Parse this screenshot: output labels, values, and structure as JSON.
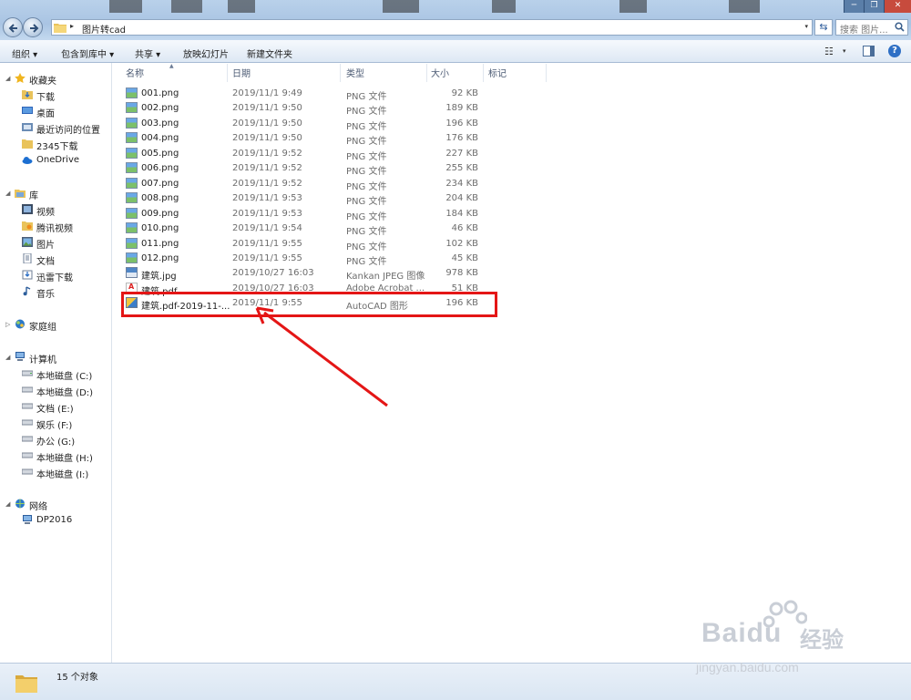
{
  "window": {
    "min_glyph": "─",
    "max_glyph": "❐",
    "close_glyph": "✕"
  },
  "address": {
    "arrow": "▸",
    "path": "图片转cad",
    "dropdown": "▾",
    "refresh_glyph": "⇆"
  },
  "search": {
    "placeholder": "搜索 图片..."
  },
  "toolbar": {
    "organize": "组织 ▾",
    "include_library": "包含到库中 ▾",
    "share": "共享 ▾",
    "slideshow": "放映幻灯片",
    "new_folder": "新建文件夹",
    "view_glyph": "☷",
    "view_dd": "▾",
    "help": "?"
  },
  "nav": {
    "favorites": {
      "label": "收藏夹",
      "items": [
        "下载",
        "桌面",
        "最近访问的位置",
        "2345下载",
        "OneDrive"
      ]
    },
    "libraries": {
      "label": "库",
      "items": [
        "视频",
        "腾讯视频",
        "图片",
        "文档",
        "迅雷下载",
        "音乐"
      ]
    },
    "homegroup": {
      "label": "家庭组"
    },
    "computer": {
      "label": "计算机",
      "items": [
        "本地磁盘 (C:)",
        "本地磁盘 (D:)",
        "文档 (E:)",
        "娱乐 (F:)",
        "办公 (G:)",
        "本地磁盘 (H:)",
        "本地磁盘 (I:)"
      ]
    },
    "network": {
      "label": "网络",
      "items": [
        "DP2016"
      ]
    }
  },
  "columns": {
    "name": "名称",
    "date": "日期",
    "type": "类型",
    "size": "大小",
    "tags": "标记"
  },
  "files": [
    {
      "name": "001.png",
      "date": "2019/11/1 9:49",
      "type": "PNG 文件",
      "size": "92 KB"
    },
    {
      "name": "002.png",
      "date": "2019/11/1 9:50",
      "type": "PNG 文件",
      "size": "189 KB"
    },
    {
      "name": "003.png",
      "date": "2019/11/1 9:50",
      "type": "PNG 文件",
      "size": "196 KB"
    },
    {
      "name": "004.png",
      "date": "2019/11/1 9:50",
      "type": "PNG 文件",
      "size": "176 KB"
    },
    {
      "name": "005.png",
      "date": "2019/11/1 9:52",
      "type": "PNG 文件",
      "size": "227 KB"
    },
    {
      "name": "006.png",
      "date": "2019/11/1 9:52",
      "type": "PNG 文件",
      "size": "255 KB"
    },
    {
      "name": "007.png",
      "date": "2019/11/1 9:52",
      "type": "PNG 文件",
      "size": "234 KB"
    },
    {
      "name": "008.png",
      "date": "2019/11/1 9:53",
      "type": "PNG 文件",
      "size": "204 KB"
    },
    {
      "name": "009.png",
      "date": "2019/11/1 9:53",
      "type": "PNG 文件",
      "size": "184 KB"
    },
    {
      "name": "010.png",
      "date": "2019/11/1 9:54",
      "type": "PNG 文件",
      "size": "46 KB"
    },
    {
      "name": "011.png",
      "date": "2019/11/1 9:55",
      "type": "PNG 文件",
      "size": "102 KB"
    },
    {
      "name": "012.png",
      "date": "2019/11/1 9:55",
      "type": "PNG 文件",
      "size": "45 KB"
    },
    {
      "name": "建筑.jpg",
      "date": "2019/10/27 16:03",
      "type": "Kankan JPEG 图像",
      "size": "978 KB"
    },
    {
      "name": "建筑.pdf",
      "date": "2019/10/27 16:03",
      "type": "Adobe Acrobat ...",
      "size": "51 KB"
    },
    {
      "name": "建筑.pdf-2019-11-...",
      "date": "2019/11/1 9:55",
      "type": "AutoCAD 图形",
      "size": "196 KB"
    }
  ],
  "status": {
    "count": "15 个对象"
  },
  "watermark": {
    "text": "Baidu",
    "cn": "经验",
    "sub": "jingyan.baidu.com"
  },
  "colors": {
    "highlight": "#e41616",
    "arrow": "#e41616"
  }
}
